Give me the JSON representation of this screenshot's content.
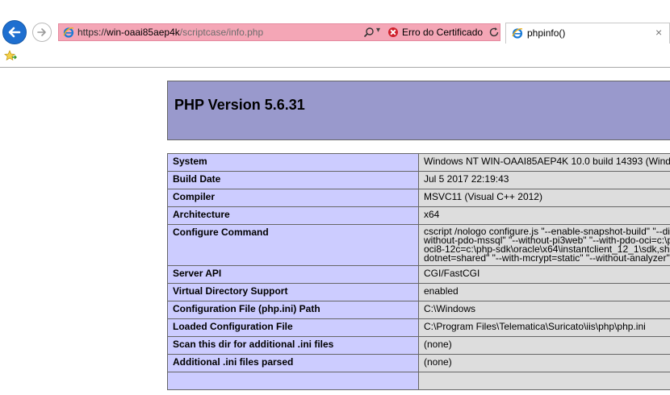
{
  "browser": {
    "address": {
      "scheme": "https://",
      "host": "win-oaai85aep4k",
      "path": "/scriptcase/info.php"
    },
    "certificate_error": "Erro do Certificado",
    "tab_title": "phpinfo()",
    "tab_close": "×",
    "search_dropdown": "▾"
  },
  "page": {
    "title": "PHP Version 5.6.31",
    "rows": [
      {
        "label": "System",
        "value": [
          "Windows NT WIN-OAAI85AEP4K 10.0 build 14393 (Wind"
        ]
      },
      {
        "label": "Build Date",
        "value": [
          "Jul 5 2017 22:19:43"
        ]
      },
      {
        "label": "Compiler",
        "value": [
          "MSVC11 (Visual C++ 2012)"
        ]
      },
      {
        "label": "Architecture",
        "value": [
          "x64"
        ]
      },
      {
        "label": "Configure Command",
        "value": [
          "cscript /nologo configure.js \"--enable-snapshot-build\" \"--di",
          "without-pdo-mssql\" \"--without-pi3web\" \"--with-pdo-oci=c:\\p",
          "oci8-12c=c:\\php-sdk\\oracle\\x64\\instantclient_12_1\\sdk,sha",
          "dotnet=shared\" \"--with-mcrypt=static\" \"--without-analyzer\""
        ]
      },
      {
        "label": "Server API",
        "value": [
          "CGI/FastCGI"
        ]
      },
      {
        "label": "Virtual Directory Support",
        "value": [
          "enabled"
        ]
      },
      {
        "label": "Configuration File (php.ini) Path",
        "value": [
          "C:\\Windows"
        ]
      },
      {
        "label": "Loaded Configuration File",
        "value": [
          "C:\\Program Files\\Telematica\\Suricato\\iis\\php\\php.ini"
        ]
      },
      {
        "label": "Scan this dir for additional .ini files",
        "value": [
          "(none)"
        ]
      },
      {
        "label": "Additional .ini files parsed",
        "value": [
          "(none)"
        ]
      }
    ]
  },
  "colors": {
    "header_bg": "#9999cc",
    "label_bg": "#ccccff",
    "value_bg": "#dddddd",
    "address_error_bg": "#f4a6b6",
    "ie_blue": "#1e6fd0"
  },
  "icons": {
    "back": "back-arrow-icon",
    "forward": "forward-arrow-icon",
    "favicon": "internet-explorer-icon",
    "search": "search-icon",
    "certificate": "certificate-error-icon",
    "refresh": "refresh-icon",
    "favorites": "favorites-star-icon"
  }
}
